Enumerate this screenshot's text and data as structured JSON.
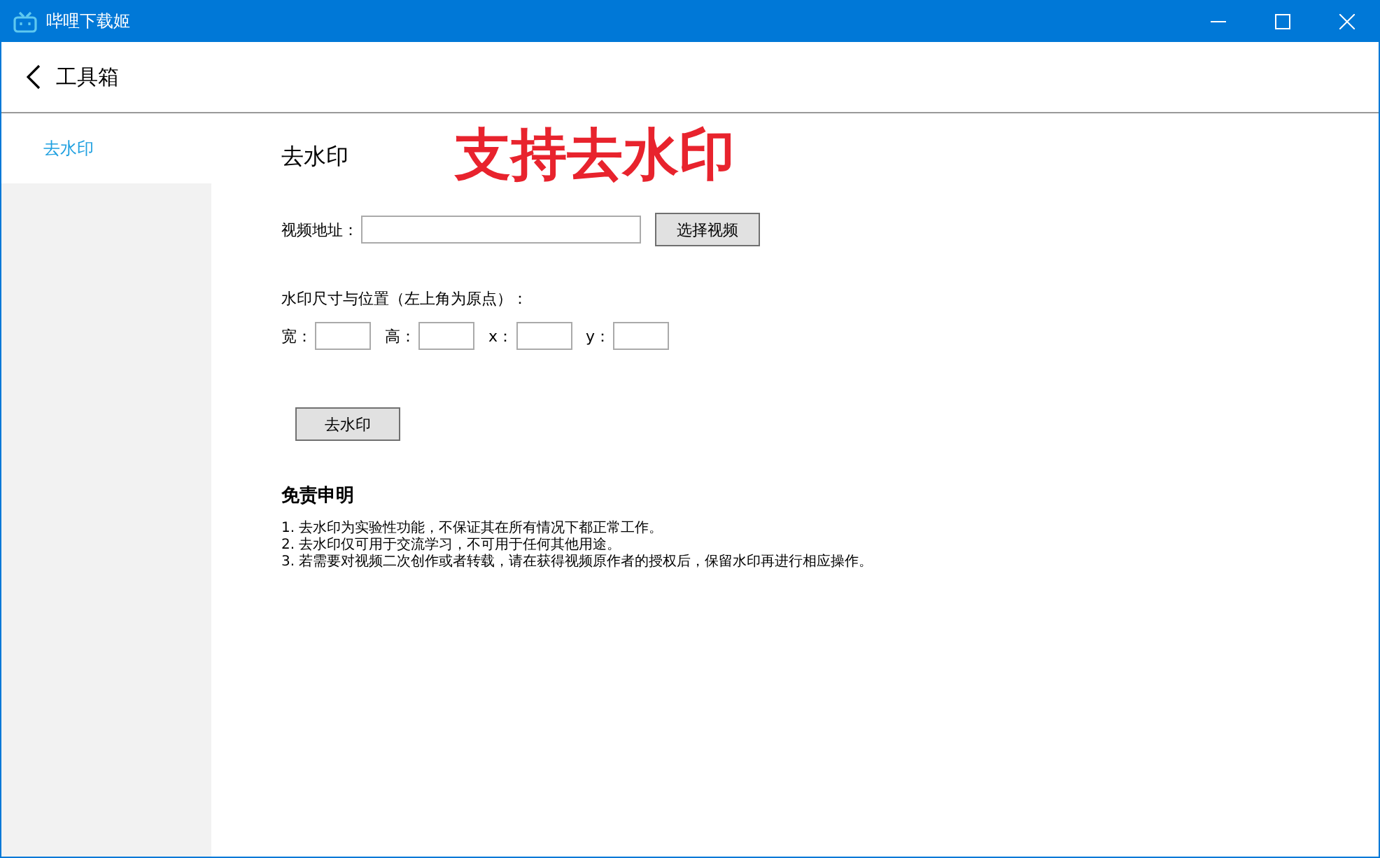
{
  "window": {
    "title": "哔哩下载姬"
  },
  "header": {
    "title": "工具箱"
  },
  "sidebar": {
    "items": [
      {
        "label": "去水印",
        "selected": true
      }
    ]
  },
  "page": {
    "title": "去水印",
    "annotation": "支持去水印"
  },
  "video_field": {
    "label": "视频地址："
  },
  "select_button": "选择视频",
  "size_section": {
    "label": "水印尺寸与位置（左上角为原点）：",
    "fields": [
      {
        "label": "宽："
      },
      {
        "label": "高："
      },
      {
        "label": "x："
      },
      {
        "label": "y："
      }
    ]
  },
  "remove_button": "去水印",
  "disclaimer": {
    "title": "免责申明",
    "lines": [
      "1. 去水印为实验性功能，不保证其在所有情况下都正常工作。",
      "2. 去水印仅可用于交流学习，不可用于任何其他用途。",
      "3. 若需要对视频二次创作或者转载，请在获得视频原作者的授权后，保留水印再进行相应操作。"
    ]
  }
}
